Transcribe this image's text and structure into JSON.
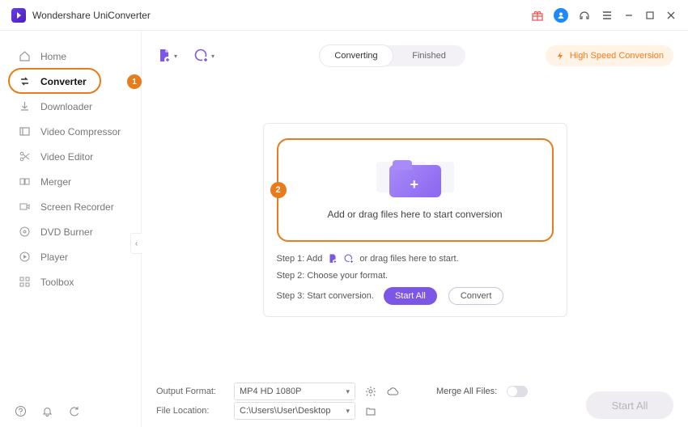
{
  "title": "Wondershare UniConverter",
  "sidebar": {
    "items": [
      {
        "label": "Home"
      },
      {
        "label": "Converter"
      },
      {
        "label": "Downloader"
      },
      {
        "label": "Video Compressor"
      },
      {
        "label": "Video Editor"
      },
      {
        "label": "Merger"
      },
      {
        "label": "Screen Recorder"
      },
      {
        "label": "DVD Burner"
      },
      {
        "label": "Player"
      },
      {
        "label": "Toolbox"
      }
    ],
    "badge1": "1"
  },
  "tabs": {
    "converting": "Converting",
    "finished": "Finished"
  },
  "hsc": "High Speed Conversion",
  "drop": {
    "badge": "2",
    "text": "Add or drag files here to start conversion"
  },
  "steps": {
    "s1a": "Step 1: Add",
    "s1b": "or drag files here to start.",
    "s2": "Step 2: Choose your format.",
    "s3": "Step 3: Start conversion.",
    "startAll": "Start All",
    "convert": "Convert"
  },
  "footer": {
    "outLabel": "Output Format:",
    "outValue": "MP4 HD 1080P",
    "locLabel": "File Location:",
    "locValue": "C:\\Users\\User\\Desktop",
    "mergeLabel": "Merge All Files:",
    "startAll": "Start All"
  }
}
